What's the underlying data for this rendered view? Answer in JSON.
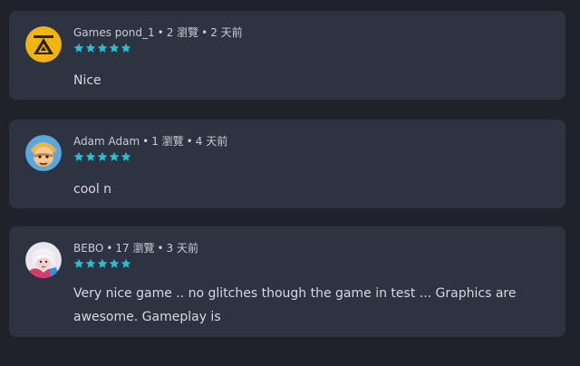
{
  "colors": {
    "background": "#1f222b",
    "card": "#2e3341",
    "star": "#1fc2d9",
    "meta_text": "#c9ccd4",
    "body_text": "#d6d8de"
  },
  "reviews": [
    {
      "author": "Games pond_1",
      "views": "2 瀏覽",
      "time": "2 天前",
      "stars": 5,
      "text": "Nice",
      "avatar_icon": "triangle-logo-avatar-icon"
    },
    {
      "author": "Adam Adam",
      "views": "1 瀏覽",
      "time": "4 天前",
      "stars": 5,
      "text": "cool n",
      "avatar_icon": "barbarian-face-avatar-icon"
    },
    {
      "author": "BEBO",
      "views": "17 瀏覽",
      "time": "3 天前",
      "stars": 5,
      "text": "Very nice game .. no glitches though the game in test ... Graphics are awesome. Gameplay is",
      "avatar_icon": "character-portrait-avatar-icon"
    }
  ]
}
